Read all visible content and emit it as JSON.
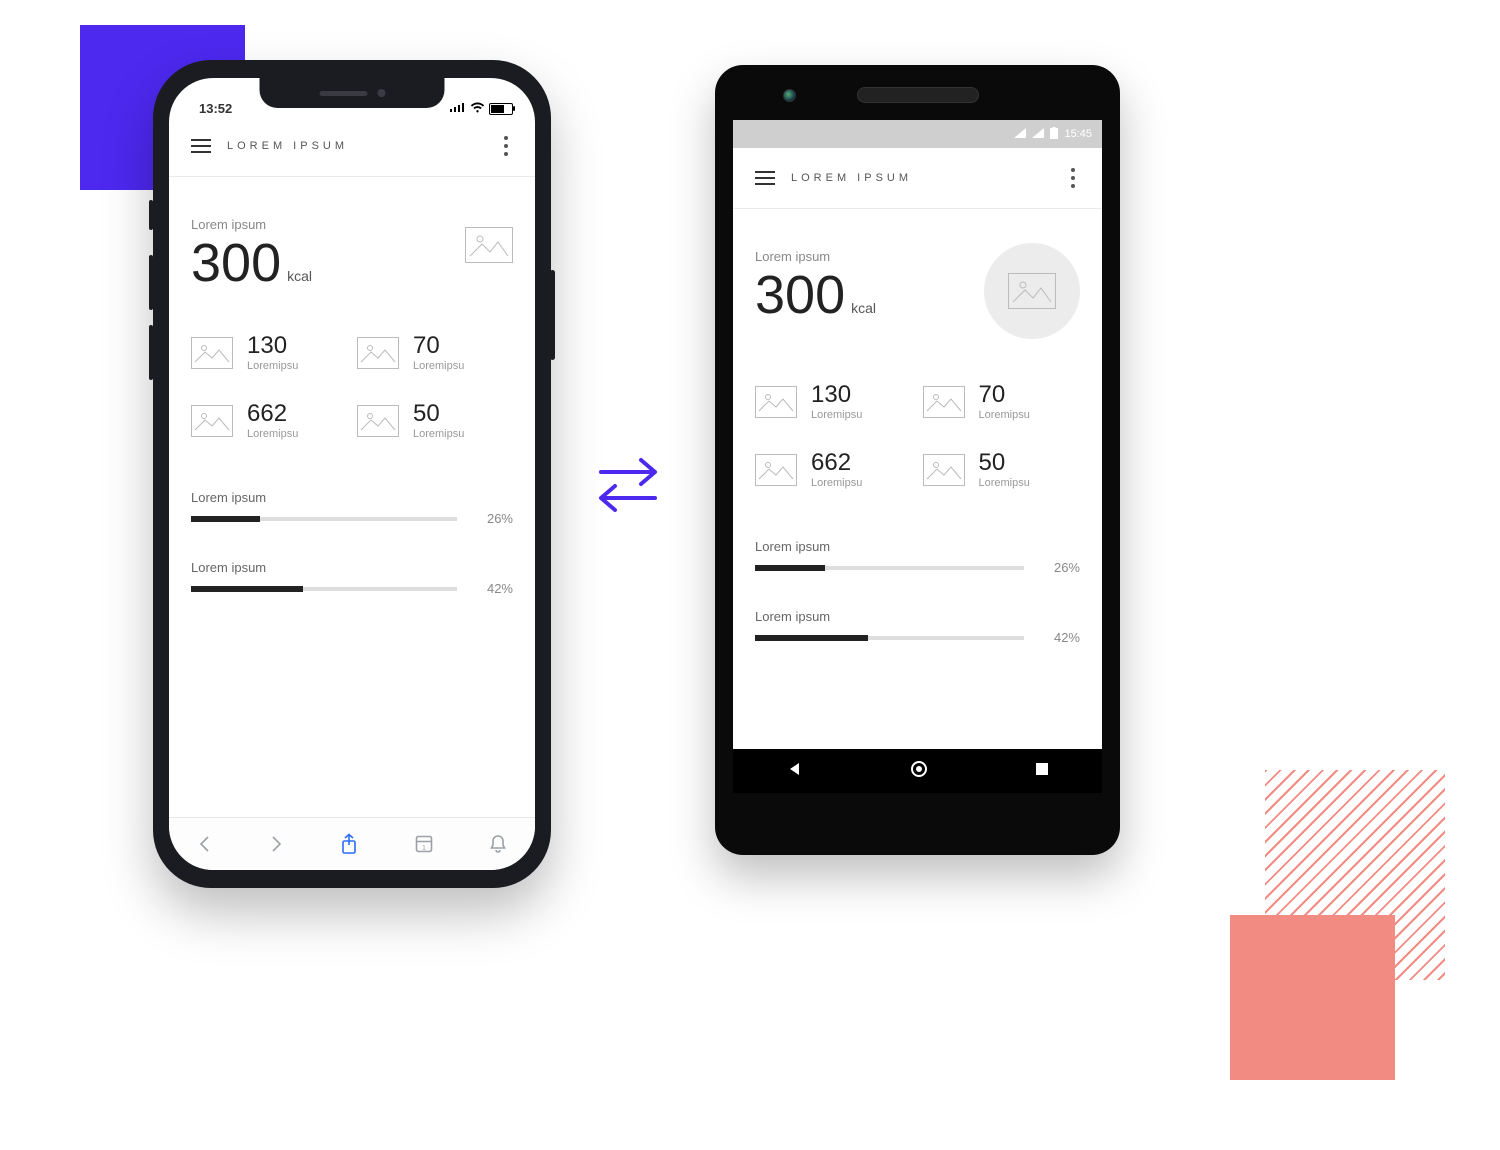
{
  "ios": {
    "statusbar": {
      "time": "13:52"
    }
  },
  "android": {
    "statusbar": {
      "time": "15:45"
    }
  },
  "app": {
    "title": "LOREM IPSUM",
    "hero": {
      "label": "Lorem ipsum",
      "value": "300",
      "unit": "kcal"
    },
    "stats": [
      {
        "value": "130",
        "label": "Loremipsu"
      },
      {
        "value": "70",
        "label": "Loremipsu"
      },
      {
        "value": "662",
        "label": "Loremipsu"
      },
      {
        "value": "50",
        "label": "Loremipsu"
      }
    ],
    "progress": [
      {
        "label": "Lorem ipsum",
        "pct": 26,
        "pct_label": "26%"
      },
      {
        "label": "Lorem ipsum",
        "pct": 42,
        "pct_label": "42%"
      }
    ]
  }
}
